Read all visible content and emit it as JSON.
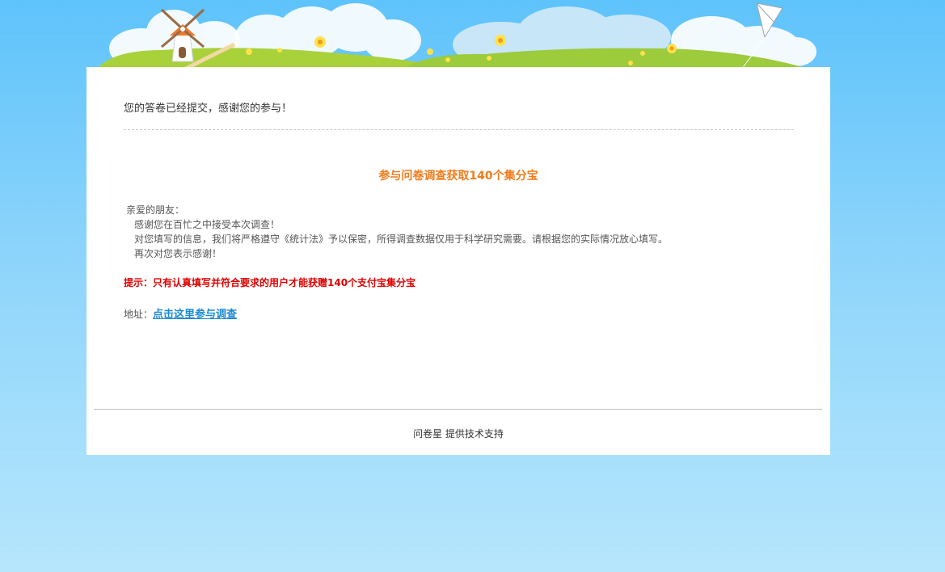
{
  "colors": {
    "accent_orange": "#f07c1c",
    "tip_red": "#e00000",
    "link_blue": "#1a8ad2"
  },
  "header": {
    "icons": [
      "cloud-icon",
      "windmill-icon",
      "flower-icon",
      "kite-icon",
      "hill-icon"
    ]
  },
  "main": {
    "submitted_message": "您的答卷已经提交，感谢您的参与！",
    "survey_heading": "参与问卷调查获取140个集分宝",
    "body": {
      "greeting": "亲爱的朋友：",
      "lines": [
        "感谢您在百忙之中接受本次调查！",
        "对您填写的信息，我们将严格遵守《统计法》予以保密，所得调查数据仅用于科学研究需要。请根据您的实际情况放心填写。",
        "再次对您表示感谢！"
      ]
    },
    "tip": "提示：只有认真填写并符合要求的用户才能获赠140个支付宝集分宝",
    "address": {
      "label": "地址：",
      "link_text": "点击这里参与调查"
    }
  },
  "footer": {
    "text": "问卷星 提供技术支持"
  }
}
